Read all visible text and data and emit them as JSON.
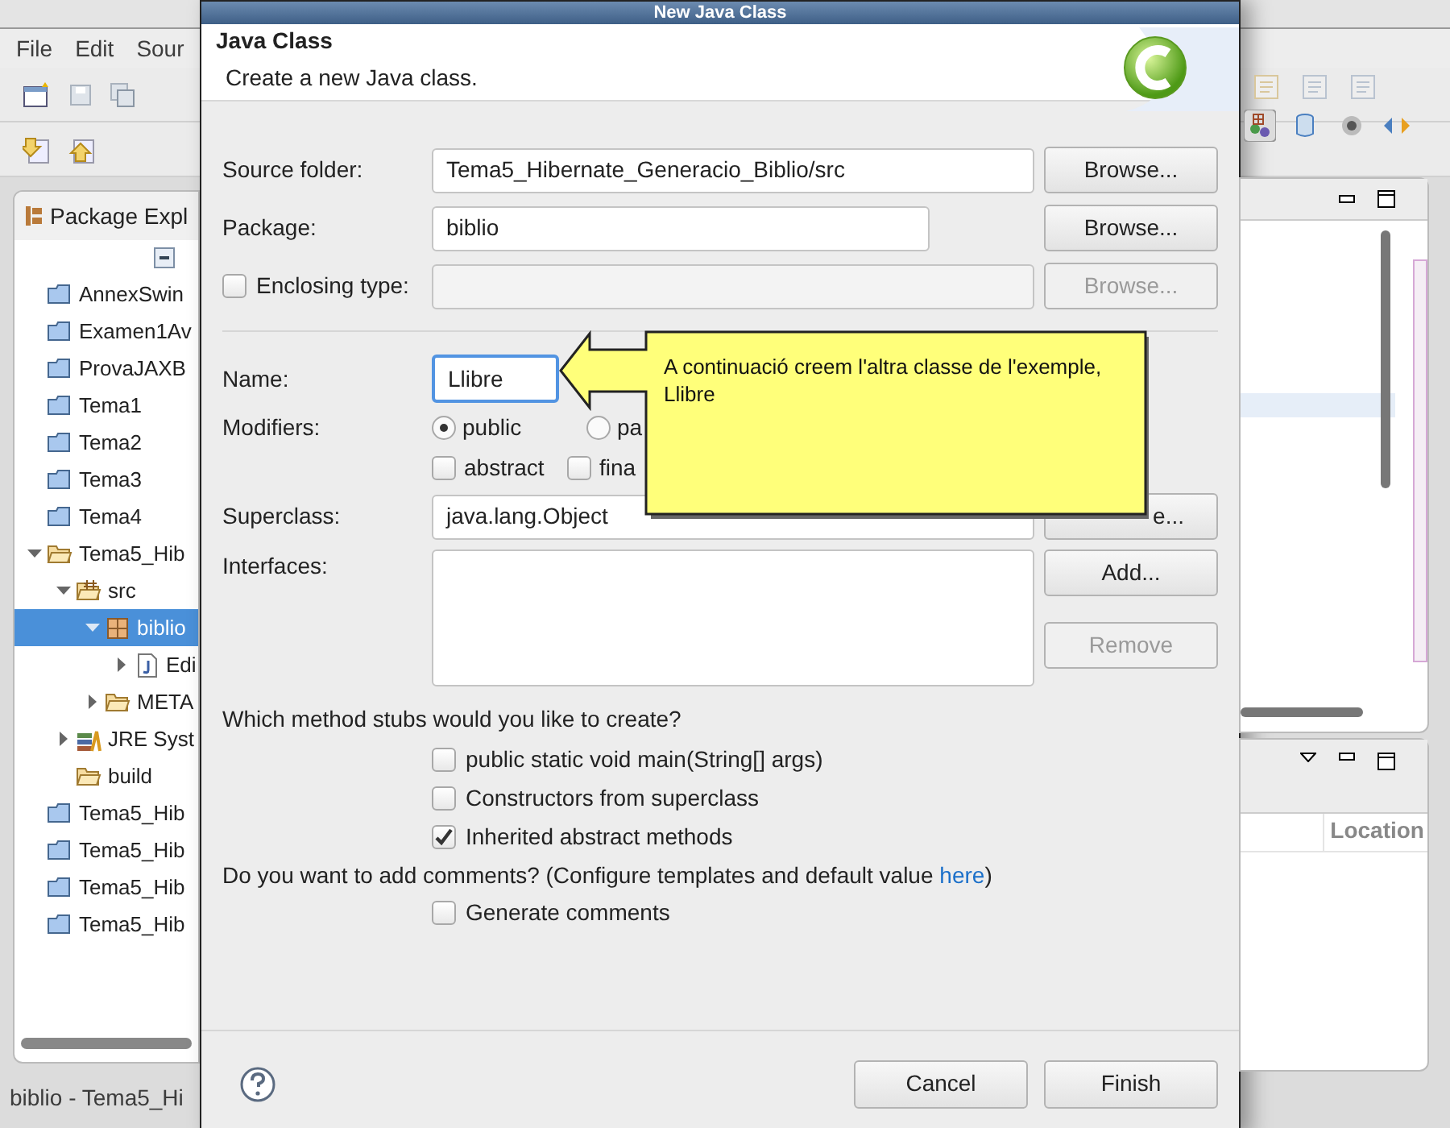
{
  "ide": {
    "menu": [
      "File",
      "Edit",
      "Sour"
    ],
    "package_explorer": {
      "title": "Package Expl",
      "tree": [
        {
          "label": "AnnexSwin",
          "kind": "project",
          "selected": false
        },
        {
          "label": "Examen1Av",
          "kind": "project",
          "selected": false
        },
        {
          "label": "ProvaJAXB",
          "kind": "project",
          "selected": false
        },
        {
          "label": "Tema1",
          "kind": "project",
          "selected": false
        },
        {
          "label": "Tema2",
          "kind": "project",
          "selected": false
        },
        {
          "label": "Tema3",
          "kind": "project",
          "selected": false
        },
        {
          "label": "Tema4",
          "kind": "project",
          "selected": false
        },
        {
          "label": "Tema5_Hib",
          "kind": "open-project",
          "selected": false,
          "expanded": true,
          "children": [
            {
              "label": "src",
              "kind": "source-folder",
              "selected": false,
              "expanded": true,
              "children": [
                {
                  "label": "biblio",
                  "kind": "package",
                  "selected": true,
                  "expanded": true,
                  "children": [
                    {
                      "label": "Edi",
                      "kind": "java-file",
                      "selected": false,
                      "expanded": false
                    }
                  ]
                },
                {
                  "label": "META",
                  "kind": "folder",
                  "selected": false,
                  "expanded": false
                }
              ]
            },
            {
              "label": "JRE Syst",
              "kind": "library",
              "selected": false,
              "expanded": false
            },
            {
              "label": "build",
              "kind": "folder",
              "selected": false
            }
          ]
        },
        {
          "label": "Tema5_Hib",
          "kind": "project",
          "selected": false
        },
        {
          "label": "Tema5_Hib",
          "kind": "project",
          "selected": false
        },
        {
          "label": "Tema5_Hib",
          "kind": "project",
          "selected": false
        },
        {
          "label": "Tema5_Hib",
          "kind": "project",
          "selected": false
        }
      ]
    },
    "bottom_panel": {
      "column": "Location"
    },
    "status_bar": "biblio - Tema5_Hi"
  },
  "dialog": {
    "title": "New Java Class",
    "heading": "Java Class",
    "description": "Create a new Java class.",
    "source_folder": {
      "label": "Source folder:",
      "value": "Tema5_Hibernate_Generacio_Biblio/src",
      "button": "Browse..."
    },
    "package": {
      "label": "Package:",
      "value": "biblio",
      "button": "Browse..."
    },
    "enclosing_type": {
      "label": "Enclosing type:",
      "checked": false,
      "button": "Browse...",
      "disabled": true
    },
    "name": {
      "label": "Name:",
      "value": "Llibre"
    },
    "modifiers": {
      "label": "Modifiers:",
      "radios": [
        {
          "label": "public",
          "selected": true
        },
        {
          "label": "pa",
          "selected": false
        }
      ],
      "checks": [
        {
          "label": "abstract",
          "checked": false
        },
        {
          "label": "fina",
          "checked": false
        }
      ]
    },
    "superclass": {
      "label": "Superclass:",
      "value": "java.lang.Object",
      "button": "e..."
    },
    "interfaces": {
      "label": "Interfaces:",
      "buttons": [
        {
          "label": "Add...",
          "disabled": false
        },
        {
          "label": "Remove",
          "disabled": true
        }
      ]
    },
    "stubs_question": "Which method stubs would you like to create?",
    "stubs": [
      {
        "label": "public static void main(String[] args)",
        "checked": false
      },
      {
        "label": "Constructors from superclass",
        "checked": false
      },
      {
        "label": "Inherited abstract methods",
        "checked": true
      }
    ],
    "comments_question": {
      "text": "Do you want to add comments? (Configure templates and default value ",
      "link": "here",
      "after": ")"
    },
    "generate_comments": {
      "label": "Generate comments",
      "checked": false
    },
    "buttons": [
      "Cancel",
      "Finish"
    ]
  },
  "callout": {
    "text": "A continuació creem l'altra classe de l'exemple, Llibre"
  }
}
